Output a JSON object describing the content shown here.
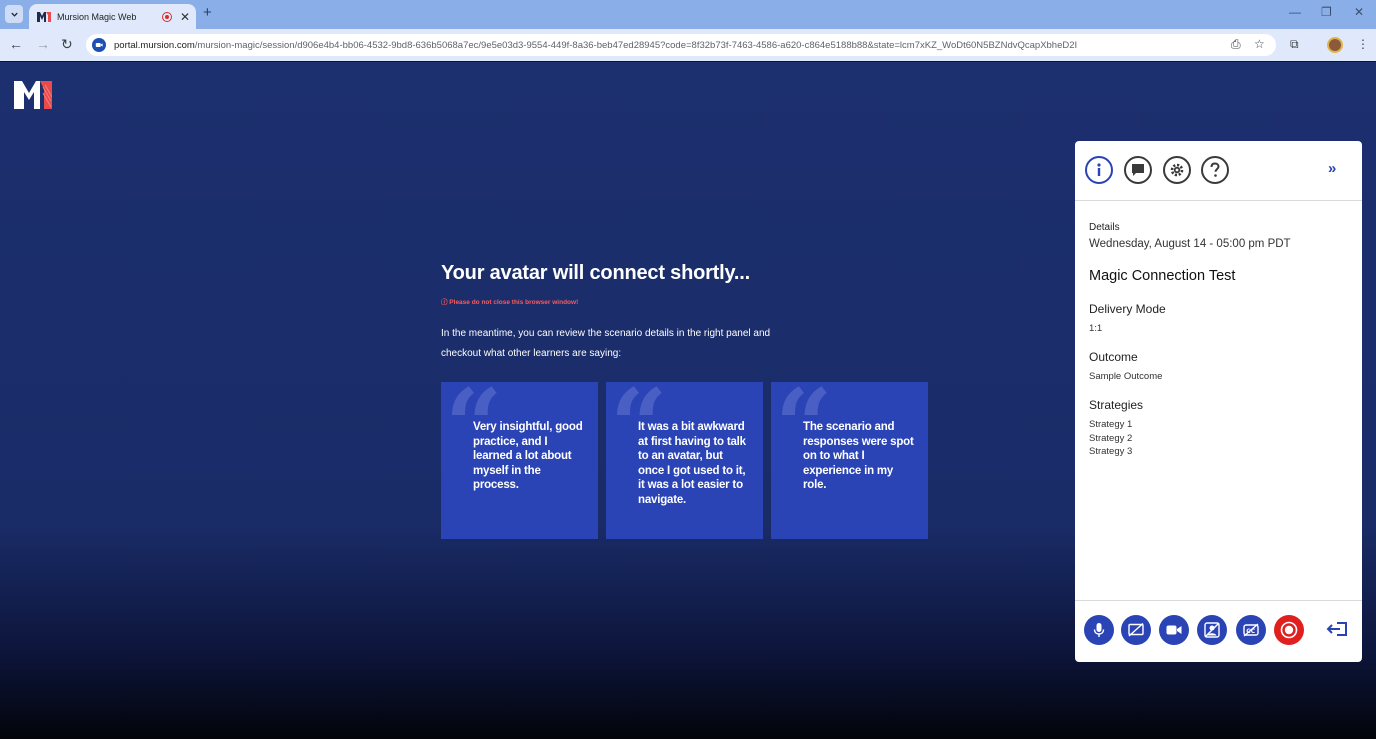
{
  "browser": {
    "tab_title": "Mursion Magic Web",
    "new_tab_label": "+",
    "url_host": "portal.mursion.com",
    "url_path": "/mursion-magic/session/d906e4b4-bb06-4532-9bd8-636b5068a7ec/9e5e03d3-9554-449f-8a36-beb47ed28945?code=8f32b73f-7463-4586-a620-c864e5188b88&state=lcm7xKZ_WoDt60N5BZNdvQcapXbheD2I"
  },
  "main": {
    "title": "Your avatar will connect shortly...",
    "warning": "ⓘ Please do not close this browser window!",
    "intro": "In the meantime, you can review the scenario details in the right panel and checkout what other learners are saying:",
    "quotes": [
      "Very insightful, good practice, and I learned a lot about myself in the process.",
      "It was a bit awkward at first having to talk to an avatar, but once I got used to it, it was a lot easier to navigate.",
      "The scenario and responses were spot on to what I experience in my role."
    ]
  },
  "panel": {
    "details_label": "Details",
    "datetime": "Wednesday, August 14 - 05:00 pm PDT",
    "session_title": "Magic Connection Test",
    "delivery_mode_label": "Delivery Mode",
    "delivery_mode_value": "1:1",
    "outcome_label": "Outcome",
    "outcome_value": "Sample Outcome",
    "strategies_label": "Strategies",
    "strategies": [
      "Strategy 1",
      "Strategy 2",
      "Strategy 3"
    ]
  },
  "colors": {
    "brand_blue": "#2a43b5",
    "page_background": "#1c2f6e",
    "warning_red": "#ff5a5a",
    "record_red": "#e01f1f"
  },
  "icons": {
    "panel_tabs": [
      "info-icon",
      "chat-icon",
      "gear-icon",
      "help-icon"
    ],
    "controls": [
      "microphone-icon",
      "screen-share-off-icon",
      "video-camera-icon",
      "avatar-view-off-icon",
      "captions-off-icon",
      "record-icon",
      "exit-session-icon"
    ]
  }
}
